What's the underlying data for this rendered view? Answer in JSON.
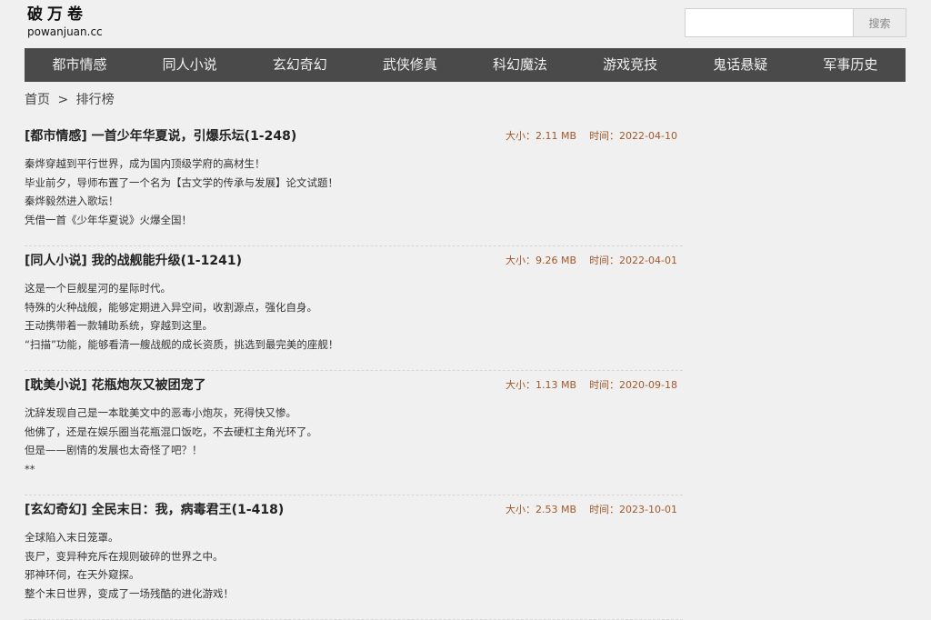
{
  "header": {
    "logo_cn": "破万卷",
    "logo_en": "powanjuan.cc",
    "search_placeholder": "",
    "search_button": "搜索"
  },
  "nav": {
    "items": [
      {
        "label": "都市情感"
      },
      {
        "label": "同人小说"
      },
      {
        "label": "玄幻奇幻"
      },
      {
        "label": "武侠修真"
      },
      {
        "label": "科幻魔法"
      },
      {
        "label": "游戏竞技"
      },
      {
        "label": "鬼话悬疑"
      },
      {
        "label": "军事历史"
      }
    ]
  },
  "breadcrumb": {
    "home": "首页",
    "separator": ">",
    "current": "排行榜"
  },
  "books": [
    {
      "title": "[都市情感] 一首少年华夏说，引爆乐坛(1-248)",
      "size": "大小：2.11 MB",
      "time": "时间：2022-04-10",
      "lines": [
        "秦烨穿越到平行世界，成为国内顶级学府的高材生！",
        "毕业前夕，导师布置了一个名为【古文学的传承与发展】论文试题！",
        "秦烨毅然进入歌坛！",
        "凭借一首《少年华夏说》火爆全国！"
      ]
    },
    {
      "title": "[同人小说] 我的战舰能升级(1-1241)",
      "size": "大小：9.26 MB",
      "time": "时间：2022-04-01",
      "lines": [
        "这是一个巨舰星河的星际时代。",
        "特殊的火种战舰，能够定期进入异空间，收割源点，强化自身。",
        "王动携带着一款辅助系统，穿越到这里。",
        "“扫描”功能，能够看清一艘战舰的成长资质，挑选到最完美的座舰！"
      ]
    },
    {
      "title": "[耽美小说] 花瓶炮灰又被团宠了",
      "size": "大小：1.13 MB",
      "time": "时间：2020-09-18",
      "lines": [
        "沈辞发现自己是一本耽美文中的恶毒小炮灰，死得快又惨。",
        "他佛了，还是在娱乐圈当花瓶混口饭吃，不去硬杠主角光环了。",
        "但是——剧情的发展也太奇怪了吧？！",
        "**"
      ]
    },
    {
      "title": "[玄幻奇幻] 全民末日：我，病毒君王(1-418)",
      "size": "大小：2.53 MB",
      "time": "时间：2023-10-01",
      "lines": [
        "全球陷入末日笼罩。",
        "丧尸，变异种充斥在规则破碎的世界之中。",
        "邪神环伺，在天外窥探。",
        "整个末日世界，变成了一场残酷的进化游戏！"
      ]
    }
  ]
}
